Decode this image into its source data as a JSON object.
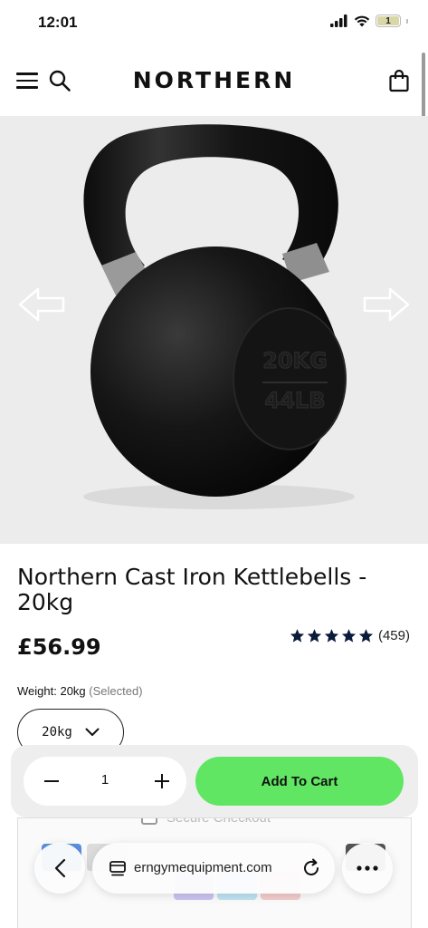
{
  "status_bar": {
    "time": "12:01",
    "battery": "1"
  },
  "header": {
    "brand": "NORTHERN"
  },
  "product": {
    "title": "Northern Cast Iron Kettlebells - 20kg",
    "price": "£56.99",
    "rating_stars": 5,
    "review_count": "(459)",
    "weight_label": "Weight:",
    "weight_value": "20kg",
    "weight_selected": "(Selected)",
    "weight_option": "20kg",
    "embossed_kg": "20KG",
    "embossed_lb": "44LB"
  },
  "cart_bar": {
    "quantity": "1",
    "add_to_cart": "Add To Cart"
  },
  "below": {
    "secure_checkout": "Secure Checkout"
  },
  "browser": {
    "url": "erngymequipment.com"
  },
  "colors": {
    "accent": "#60e663",
    "hero_bg": "#ececec",
    "text": "#111111"
  }
}
